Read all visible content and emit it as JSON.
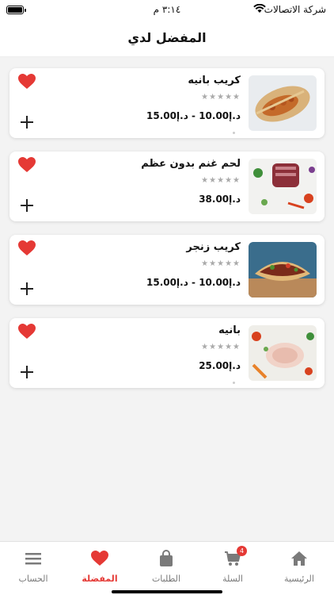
{
  "status_bar": {
    "carrier": "شركة الاتصالات",
    "time": "٣:١٤ م"
  },
  "header": {
    "title": "المفضل لدي"
  },
  "favorites": [
    {
      "name": "كريب بانيه",
      "price": "د.إ10.00 - د.إ15.00",
      "rating_stars": "★★★★★"
    },
    {
      "name": "لحم غنم بدون عظم",
      "price": "د.إ38.00",
      "rating_stars": "★★★★★"
    },
    {
      "name": "كريب زنجر",
      "price": "د.إ10.00 - د.إ15.00",
      "rating_stars": "★★★★★"
    },
    {
      "name": "بانيه",
      "price": "د.إ25.00",
      "rating_stars": "★★★★★"
    }
  ],
  "tabbar": {
    "home": "الرئيسية",
    "cart": "السلة",
    "cart_badge": "4",
    "orders": "الطلبات",
    "favorites": "المفضلة",
    "account": "الحساب"
  },
  "colors": {
    "accent": "#e53935",
    "inactive": "#7a7a7a"
  },
  "icons": [
    "wifi-icon",
    "battery-icon",
    "heart-icon",
    "plus-icon",
    "home-icon",
    "cart-icon",
    "bag-icon",
    "menu-icon"
  ]
}
